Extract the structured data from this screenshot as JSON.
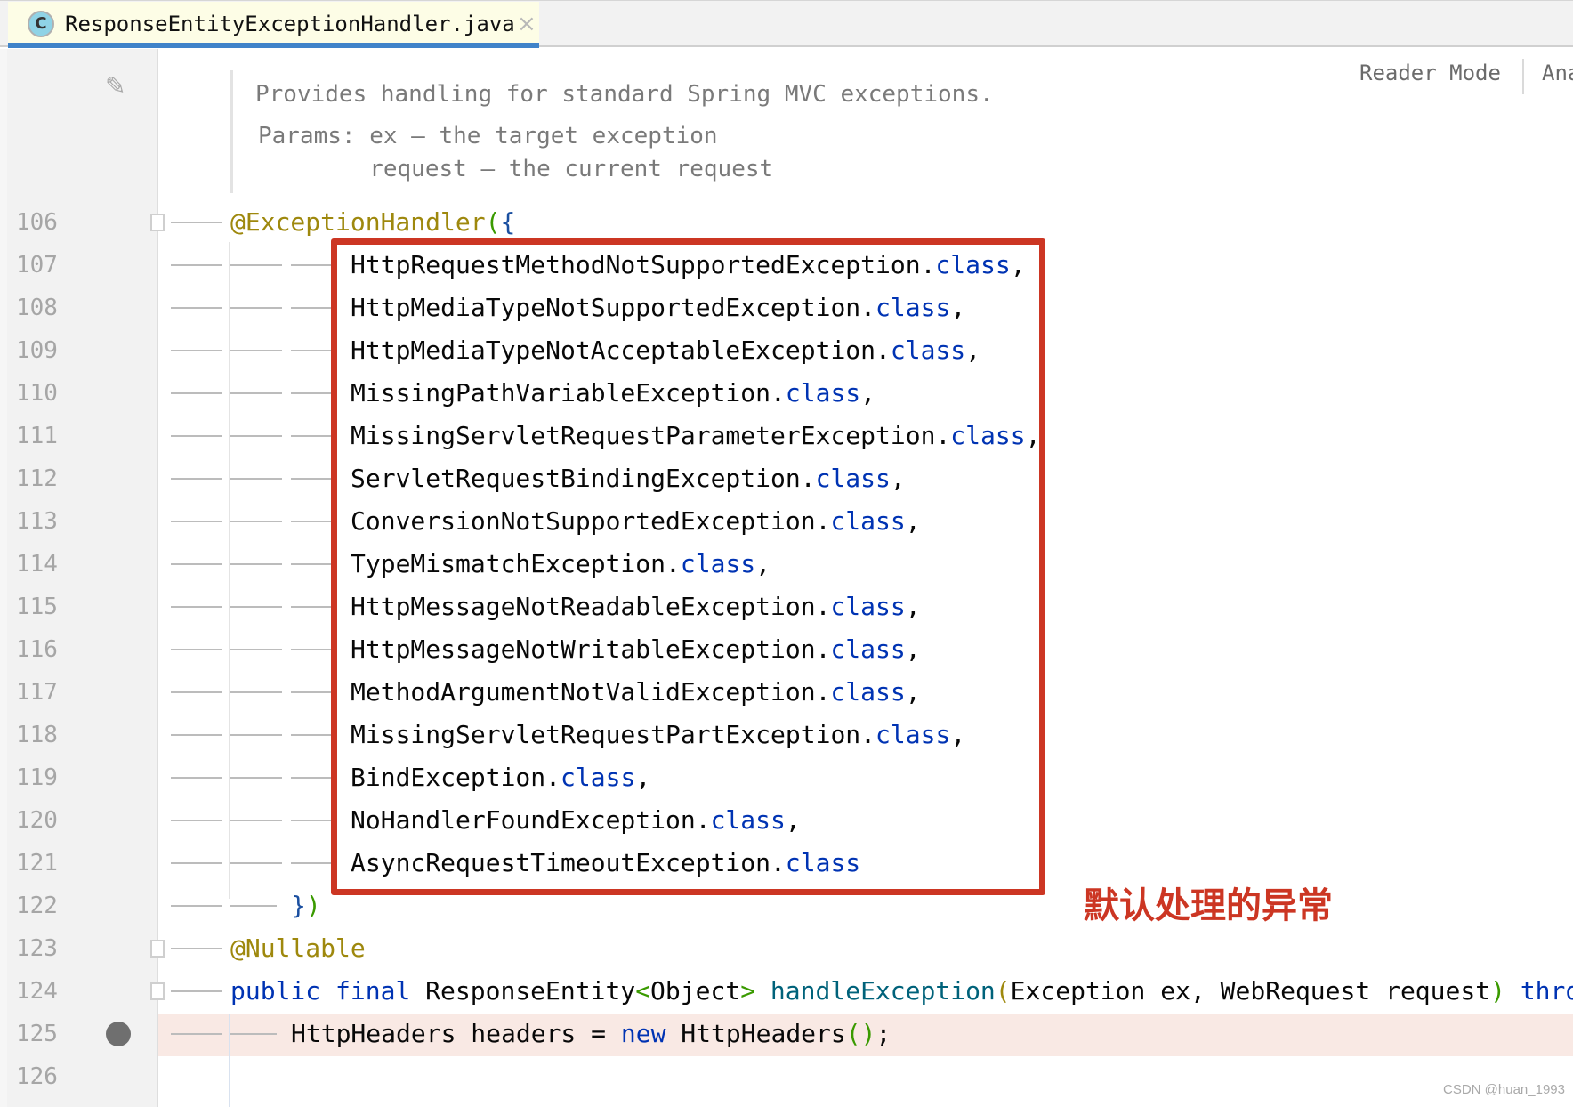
{
  "tab": {
    "icon": "class-c-icon",
    "icon_letter": "C",
    "title": "ResponseEntityExceptionHandler.java",
    "close": "×"
  },
  "toolbar": {
    "reader_mode": "Reader Mode",
    "analyze": "Ana"
  },
  "doc": {
    "line1": "Provides handling for standard Spring MVC exceptions.",
    "line2": "Params: ex – the target exception",
    "line3": "        request – the current request"
  },
  "colors": {
    "keyword": "#0033b3",
    "annotation": "#9e880d",
    "method": "#00627a",
    "plain": "#080808",
    "bracket_green": "#3a9a00",
    "bracket_blue": "#1a4fa0",
    "highlight": "#cc3623"
  },
  "annotation_label": "默认处理的异常",
  "watermark": "CSDN @huan_1993",
  "lines": [
    {
      "n": "106",
      "indent": 0,
      "tokens": [
        [
          "@ExceptionHandler",
          "annotation"
        ],
        [
          "(",
          "bracket_green"
        ],
        [
          "{",
          "bracket_blue"
        ]
      ]
    },
    {
      "n": "107",
      "indent": 2,
      "tokens": [
        [
          "HttpRequestMethodNotSupportedException.",
          "plain"
        ],
        [
          "class",
          "keyword"
        ],
        [
          ",",
          "plain"
        ]
      ]
    },
    {
      "n": "108",
      "indent": 2,
      "tokens": [
        [
          "HttpMediaTypeNotSupportedException.",
          "plain"
        ],
        [
          "class",
          "keyword"
        ],
        [
          ",",
          "plain"
        ]
      ]
    },
    {
      "n": "109",
      "indent": 2,
      "tokens": [
        [
          "HttpMediaTypeNotAcceptableException.",
          "plain"
        ],
        [
          "class",
          "keyword"
        ],
        [
          ",",
          "plain"
        ]
      ]
    },
    {
      "n": "110",
      "indent": 2,
      "tokens": [
        [
          "MissingPathVariableException.",
          "plain"
        ],
        [
          "class",
          "keyword"
        ],
        [
          ",",
          "plain"
        ]
      ]
    },
    {
      "n": "111",
      "indent": 2,
      "tokens": [
        [
          "MissingServletRequestParameterException.",
          "plain"
        ],
        [
          "class",
          "keyword"
        ],
        [
          ",",
          "plain"
        ]
      ]
    },
    {
      "n": "112",
      "indent": 2,
      "tokens": [
        [
          "ServletRequestBindingException.",
          "plain"
        ],
        [
          "class",
          "keyword"
        ],
        [
          ",",
          "plain"
        ]
      ]
    },
    {
      "n": "113",
      "indent": 2,
      "tokens": [
        [
          "ConversionNotSupportedException.",
          "plain"
        ],
        [
          "class",
          "keyword"
        ],
        [
          ",",
          "plain"
        ]
      ]
    },
    {
      "n": "114",
      "indent": 2,
      "tokens": [
        [
          "TypeMismatchException.",
          "plain"
        ],
        [
          "class",
          "keyword"
        ],
        [
          ",",
          "plain"
        ]
      ]
    },
    {
      "n": "115",
      "indent": 2,
      "tokens": [
        [
          "HttpMessageNotReadableException.",
          "plain"
        ],
        [
          "class",
          "keyword"
        ],
        [
          ",",
          "plain"
        ]
      ]
    },
    {
      "n": "116",
      "indent": 2,
      "tokens": [
        [
          "HttpMessageNotWritableException.",
          "plain"
        ],
        [
          "class",
          "keyword"
        ],
        [
          ",",
          "plain"
        ]
      ]
    },
    {
      "n": "117",
      "indent": 2,
      "tokens": [
        [
          "MethodArgumentNotValidException.",
          "plain"
        ],
        [
          "class",
          "keyword"
        ],
        [
          ",",
          "plain"
        ]
      ]
    },
    {
      "n": "118",
      "indent": 2,
      "tokens": [
        [
          "MissingServletRequestPartException.",
          "plain"
        ],
        [
          "class",
          "keyword"
        ],
        [
          ",",
          "plain"
        ]
      ]
    },
    {
      "n": "119",
      "indent": 2,
      "tokens": [
        [
          "BindException.",
          "plain"
        ],
        [
          "class",
          "keyword"
        ],
        [
          ",",
          "plain"
        ]
      ]
    },
    {
      "n": "120",
      "indent": 2,
      "tokens": [
        [
          "NoHandlerFoundException.",
          "plain"
        ],
        [
          "class",
          "keyword"
        ],
        [
          ",",
          "plain"
        ]
      ]
    },
    {
      "n": "121",
      "indent": 2,
      "tokens": [
        [
          "AsyncRequestTimeoutException.",
          "plain"
        ],
        [
          "class",
          "keyword"
        ]
      ]
    },
    {
      "n": "122",
      "indent": 1,
      "tokens": [
        [
          "}",
          "bracket_blue"
        ],
        [
          ")",
          "bracket_green"
        ]
      ]
    },
    {
      "n": "123",
      "indent": 0,
      "tokens": [
        [
          "@Nullable",
          "annotation"
        ]
      ]
    },
    {
      "n": "124",
      "indent": 0,
      "tokens": [
        [
          "public",
          "keyword"
        ],
        [
          " ",
          "plain"
        ],
        [
          "final",
          "keyword"
        ],
        [
          " ResponseEntity",
          "plain"
        ],
        [
          "<",
          "bracket_green"
        ],
        [
          "Object",
          "plain"
        ],
        [
          ">",
          "bracket_green"
        ],
        [
          " ",
          "plain"
        ],
        [
          "handleException",
          "method"
        ],
        [
          "(",
          "annotation"
        ],
        [
          "Exception ex, WebRequest request",
          "plain"
        ],
        [
          ")",
          "bracket_green"
        ],
        [
          " ",
          "plain"
        ],
        [
          "throws",
          "keyword"
        ]
      ]
    },
    {
      "n": "125",
      "indent": 1,
      "breakpoint": true,
      "tokens": [
        [
          "HttpHeaders headers = ",
          "plain"
        ],
        [
          "new",
          "keyword"
        ],
        [
          " HttpHeaders",
          "plain"
        ],
        [
          "()",
          "bracket_green"
        ],
        [
          ";",
          "plain"
        ]
      ]
    },
    {
      "n": "126",
      "indent": 0,
      "tokens": []
    }
  ]
}
